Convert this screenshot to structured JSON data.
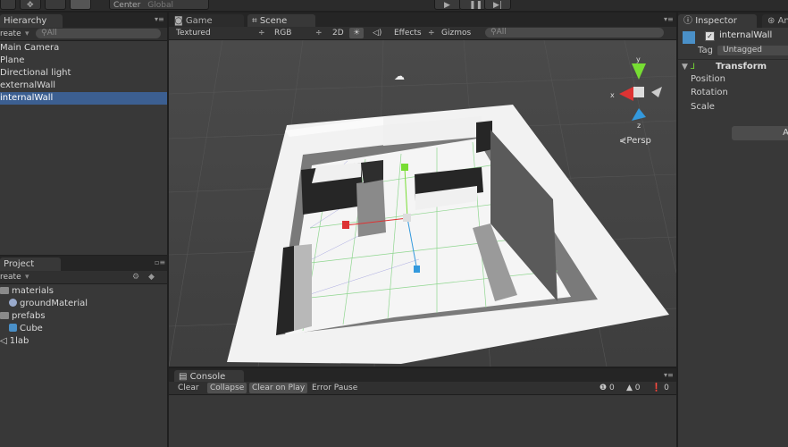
{
  "toolbar": {
    "pivot_center": "Center",
    "pivot_global": "Global"
  },
  "hierarchy": {
    "tab": "Hierarchy",
    "create": "reate",
    "search": "All",
    "items": [
      "Main Camera",
      "Plane",
      "Directional light",
      "externalWall",
      "internalWall"
    ]
  },
  "project": {
    "tab": "Project",
    "create": "reate",
    "items": [
      {
        "label": "materials",
        "kind": "folder"
      },
      {
        "label": "groundMaterial",
        "kind": "material"
      },
      {
        "label": "prefabs",
        "kind": "folder"
      },
      {
        "label": "Cube",
        "kind": "prefab"
      },
      {
        "label": "1lab",
        "kind": "scene"
      }
    ]
  },
  "scene": {
    "tab_game": "Game",
    "tab_scene": "Scene",
    "shading": "Textured",
    "color": "RGB",
    "mode2d": "2D",
    "effects": "Effects",
    "gizmos": "Gizmos",
    "search": "All",
    "persp": "Persp",
    "axis_x": "x",
    "axis_y": "y",
    "axis_z": "z"
  },
  "console": {
    "tab": "Console",
    "clear": "Clear",
    "collapse": "Collapse",
    "clear_on_play": "Clear on Play",
    "error_pause": "Error Pause",
    "count_errors": "0",
    "count_warnings": "0",
    "count_logs": "0"
  },
  "inspector": {
    "tab": "Inspector",
    "tab_other": "Ani",
    "object_name": "internalWall",
    "tag_label": "Tag",
    "tag_value": "Untagged",
    "component": "Transform",
    "props": [
      "Position",
      "Rotation",
      "Scale"
    ],
    "add_button": "A"
  },
  "colors": {
    "selection": "#3c5f91",
    "panel": "#383838",
    "scene_bg": "#444444"
  }
}
